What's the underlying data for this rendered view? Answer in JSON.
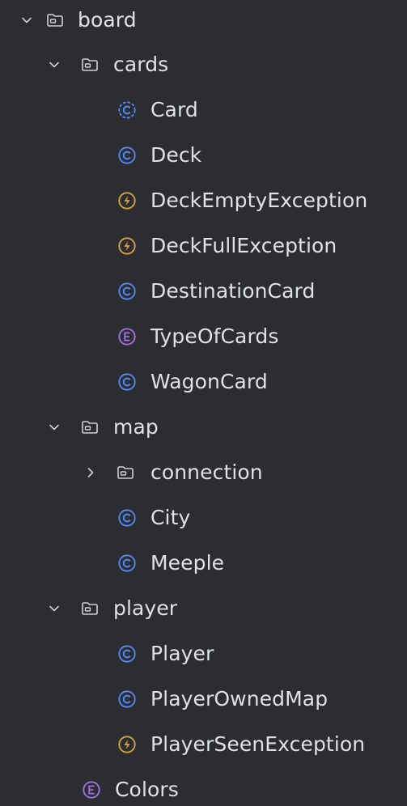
{
  "tree": {
    "board": {
      "label": "board",
      "icon": "folder-icon",
      "expanded": true
    },
    "cards": {
      "label": "cards",
      "icon": "folder-icon",
      "expanded": true,
      "children": [
        {
          "label": "Card",
          "icon": "class-icon"
        },
        {
          "label": "Deck",
          "icon": "class-icon"
        },
        {
          "label": "DeckEmptyException",
          "icon": "exception-icon"
        },
        {
          "label": "DeckFullException",
          "icon": "exception-icon"
        },
        {
          "label": "DestinationCard",
          "icon": "class-icon"
        },
        {
          "label": "TypeOfCards",
          "icon": "enum-icon"
        },
        {
          "label": "WagonCard",
          "icon": "class-icon"
        }
      ]
    },
    "map": {
      "label": "map",
      "icon": "folder-icon",
      "expanded": true,
      "connection": {
        "label": "connection",
        "icon": "folder-icon",
        "expanded": false
      },
      "children": [
        {
          "label": "City",
          "icon": "class-icon"
        },
        {
          "label": "Meeple",
          "icon": "class-icon"
        }
      ]
    },
    "player": {
      "label": "player",
      "icon": "folder-icon",
      "expanded": true,
      "children": [
        {
          "label": "Player",
          "icon": "class-icon"
        },
        {
          "label": "PlayerOwnedMap",
          "icon": "class-icon"
        },
        {
          "label": "PlayerSeenException",
          "icon": "exception-icon"
        }
      ]
    },
    "colors": {
      "label": "Colors",
      "icon": "enum-icon"
    }
  },
  "colors": {
    "background": "#2b2d30",
    "text": "#dfe1e5",
    "class_icon": "#548af7",
    "exception_icon": "#d9a343",
    "enum_icon": "#a571e6",
    "folder_icon": "#ced0d6"
  }
}
